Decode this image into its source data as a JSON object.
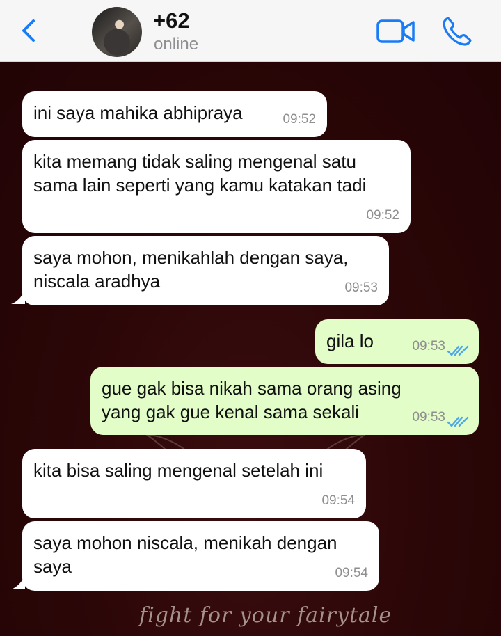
{
  "header": {
    "contact_name": "+62",
    "status": "online"
  },
  "icons": {
    "back": "chevron-left-icon",
    "video": "video-camera-icon",
    "call": "phone-icon",
    "read": "double-check-icon",
    "accent_color": "#1a7cf5",
    "read_color": "#4fa8e8"
  },
  "messages": [
    {
      "direction": "incoming",
      "text": "ini saya mahika abhipraya",
      "time": "09:52"
    },
    {
      "direction": "incoming",
      "text": "kita memang tidak saling mengenal satu sama lain seperti yang kamu katakan tadi",
      "time": "09:52"
    },
    {
      "direction": "incoming",
      "text": "saya mohon, menikahlah dengan saya, niscala aradhya",
      "time": "09:53"
    },
    {
      "direction": "outgoing",
      "text": "gila lo",
      "time": "09:53",
      "status": "read"
    },
    {
      "direction": "outgoing",
      "text": "gue gak bisa nikah sama orang asing yang gak gue kenal sama sekali",
      "time": "09:53",
      "status": "read"
    },
    {
      "direction": "incoming",
      "text": "kita bisa saling mengenal setelah ini",
      "time": "09:54"
    },
    {
      "direction": "incoming",
      "text": "saya mohon niscala, menikah dengan saya",
      "time": "09:54"
    }
  ],
  "background": {
    "watermark_text": "fight for your fairytale"
  }
}
